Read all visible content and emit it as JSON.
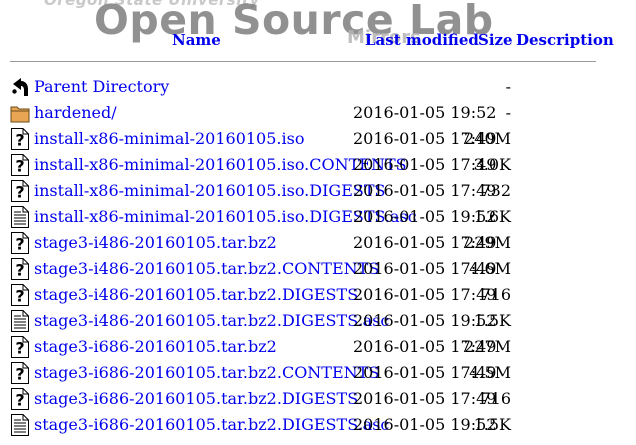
{
  "watermark": {
    "university": "Oregon State University",
    "title": "Open Source Lab",
    "subtitle": "Mirrors"
  },
  "columns": {
    "name": "Name",
    "last_modified": "Last modified",
    "size": "Size",
    "description": "Description"
  },
  "rows": [
    {
      "icon": "back-icon",
      "name": "Parent Directory",
      "date": "",
      "size": "-"
    },
    {
      "icon": "folder-icon",
      "name": "hardened/",
      "date": "2016-01-05 19:52",
      "size": "-"
    },
    {
      "icon": "unknown-file-icon",
      "name": "install-x86-minimal-20160105.iso",
      "date": "2016-01-05 17:49",
      "size": "240M"
    },
    {
      "icon": "unknown-file-icon",
      "name": "install-x86-minimal-20160105.iso.CONTENTS",
      "date": "2016-01-05 17:49",
      "size": "3.0K"
    },
    {
      "icon": "unknown-file-icon",
      "name": "install-x86-minimal-20160105.iso.DIGESTS",
      "date": "2016-01-05 17:49",
      "size": "732"
    },
    {
      "icon": "text-file-icon",
      "name": "install-x86-minimal-20160105.iso.DIGESTS.asc",
      "date": "2016-01-05 19:52",
      "size": "1.6K"
    },
    {
      "icon": "unknown-file-icon",
      "name": "stage3-i486-20160105.tar.bz2",
      "date": "2016-01-05 17:49",
      "size": "229M"
    },
    {
      "icon": "unknown-file-icon",
      "name": "stage3-i486-20160105.tar.bz2.CONTENTS",
      "date": "2016-01-05 17:49",
      "size": "4.6M"
    },
    {
      "icon": "unknown-file-icon",
      "name": "stage3-i486-20160105.tar.bz2.DIGESTS",
      "date": "2016-01-05 17:49",
      "size": "716"
    },
    {
      "icon": "text-file-icon",
      "name": "stage3-i486-20160105.tar.bz2.DIGESTS.asc",
      "date": "2016-01-05 19:52",
      "size": "1.5K"
    },
    {
      "icon": "unknown-file-icon",
      "name": "stage3-i686-20160105.tar.bz2",
      "date": "2016-01-05 17:49",
      "size": "227M"
    },
    {
      "icon": "unknown-file-icon",
      "name": "stage3-i686-20160105.tar.bz2.CONTENTS",
      "date": "2016-01-05 17:49",
      "size": "4.5M"
    },
    {
      "icon": "unknown-file-icon",
      "name": "stage3-i686-20160105.tar.bz2.DIGESTS",
      "date": "2016-01-05 17:49",
      "size": "716"
    },
    {
      "icon": "text-file-icon",
      "name": "stage3-i686-20160105.tar.bz2.DIGESTS.asc",
      "date": "2016-01-05 19:52",
      "size": "1.5K"
    }
  ]
}
